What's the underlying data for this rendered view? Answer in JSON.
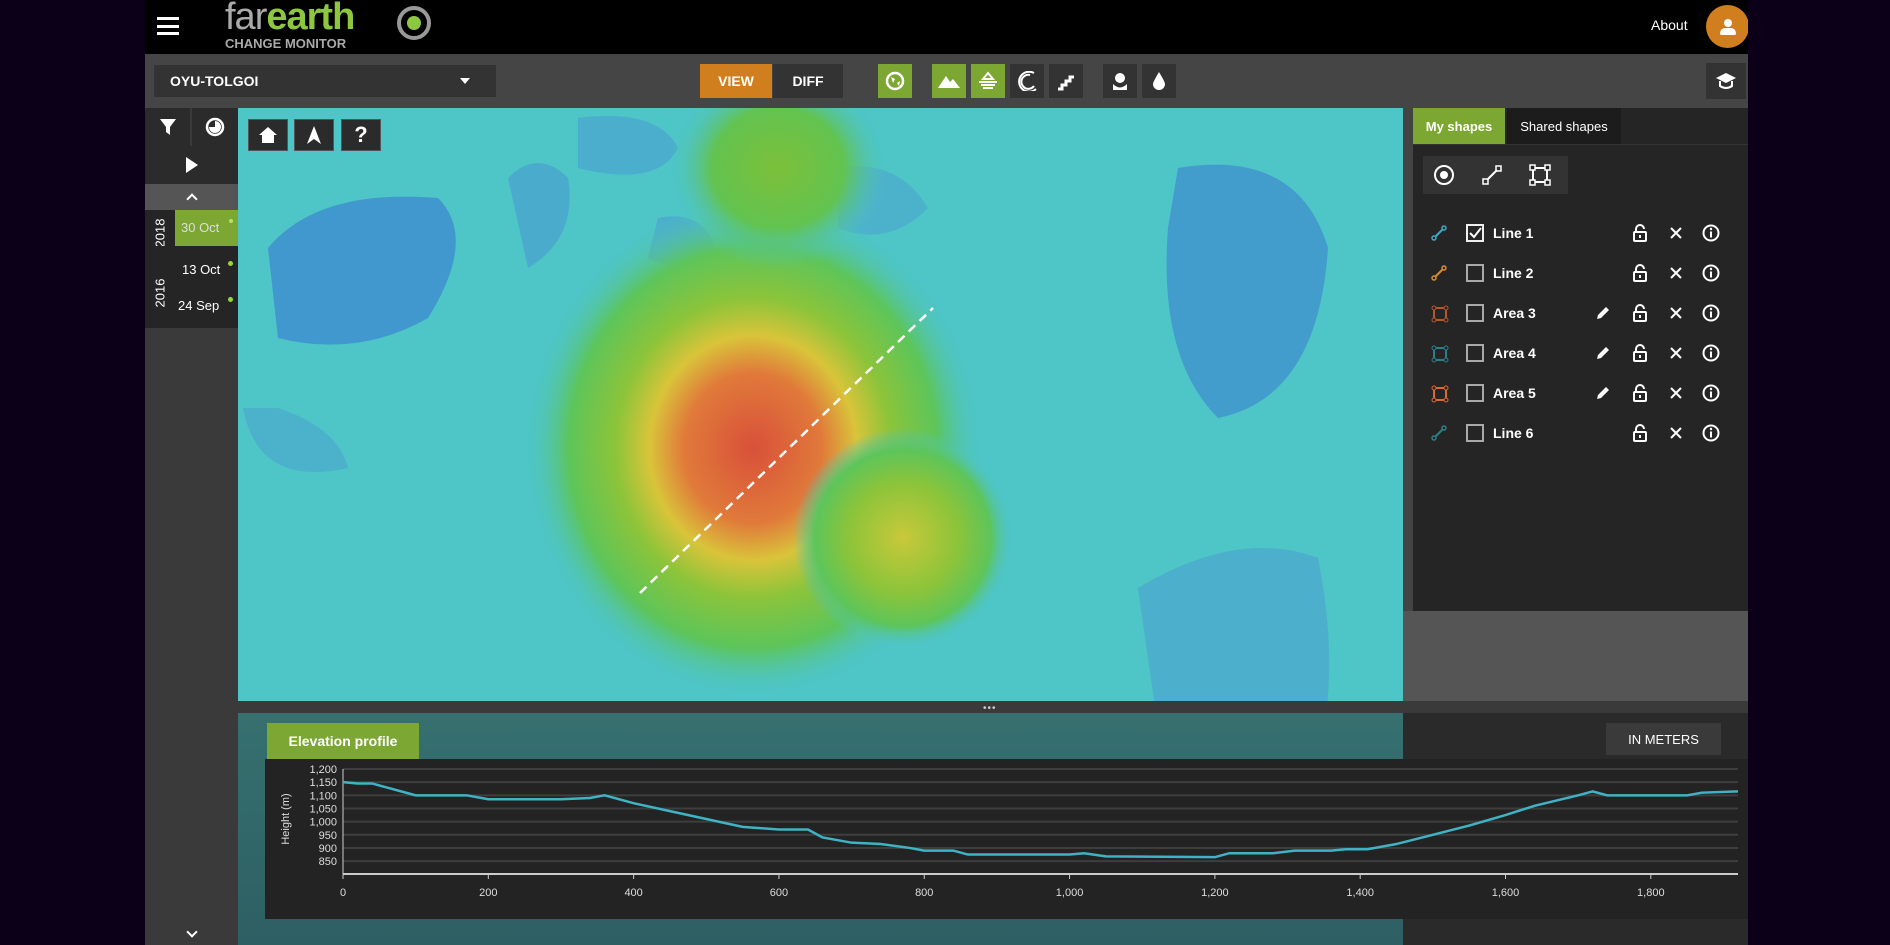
{
  "header": {
    "logo_top_far": "far",
    "logo_top_earth": "earth",
    "logo_bottom": "CHANGE MONITOR",
    "about": "About",
    "menu_icon": "hamburger-icon",
    "avatar_icon": "user-icon",
    "avatar_color": "#d17f1e"
  },
  "toolbar": {
    "site": "OYU-TOLGOI",
    "view": "VIEW",
    "diff": "DIFF",
    "accent_orange": "#d17f1e",
    "accent_green": "#7ba732",
    "icons": [
      "globe-icon",
      "mountain-icon",
      "elevation-layers-icon",
      "contour-icon",
      "stairs-icon",
      "vegetation-icon",
      "water-drop-icon",
      "learn-icon"
    ]
  },
  "sidebar": {
    "dates": [
      {
        "year": "2018",
        "items": [
          "30 Oct"
        ]
      },
      {
        "year": "2016",
        "items": [
          "13 Oct",
          "24 Sep"
        ]
      }
    ],
    "selected": "30 Oct"
  },
  "map_controls": {
    "home": "home-icon",
    "north": "north-arrow-icon",
    "help": "?"
  },
  "shapes": {
    "tabs": [
      "My shapes",
      "Shared shapes"
    ],
    "active_tab": "My shapes",
    "items": [
      {
        "name": "Line 1",
        "type": "line",
        "color": "#3aa9c4",
        "checked": true,
        "editable": false
      },
      {
        "name": "Line 2",
        "type": "line",
        "color": "#d98a2b",
        "checked": false,
        "editable": false
      },
      {
        "name": "Area 3",
        "type": "area",
        "color": "#b8562c",
        "checked": false,
        "editable": true
      },
      {
        "name": "Area 4",
        "type": "area",
        "color": "#2c7f86",
        "checked": false,
        "editable": true
      },
      {
        "name": "Area 5",
        "type": "area",
        "color": "#e0692a",
        "checked": false,
        "editable": true
      },
      {
        "name": "Line 6",
        "type": "line",
        "color": "#2c7f86",
        "checked": false,
        "editable": false
      }
    ]
  },
  "profile": {
    "tab": "Elevation profile",
    "units": "IN METERS"
  },
  "chart_data": {
    "type": "line",
    "xlabel": "",
    "ylabel": "Height (m)",
    "xlim": [
      0,
      1920
    ],
    "ylim": [
      820,
      1200
    ],
    "xticks": [
      0,
      200,
      400,
      600,
      800,
      1000,
      1200,
      1400,
      1600,
      1800
    ],
    "xtick_labels": [
      "0",
      "200",
      "400",
      "600",
      "800",
      "1,000",
      "1,200",
      "1,400",
      "1,600",
      "1,800"
    ],
    "yticks": [
      850,
      900,
      950,
      1000,
      1050,
      1100,
      1150,
      1200
    ],
    "ytick_labels": [
      "850",
      "900",
      "950",
      "1,000",
      "1,050",
      "1,100",
      "1,150",
      "1,200"
    ],
    "grid": true,
    "color": "#3fb3c4",
    "x": [
      0,
      20,
      40,
      60,
      80,
      100,
      170,
      200,
      300,
      340,
      360,
      400,
      450,
      500,
      550,
      600,
      640,
      660,
      700,
      740,
      780,
      800,
      840,
      860,
      1000,
      1020,
      1050,
      1200,
      1220,
      1280,
      1310,
      1360,
      1380,
      1410,
      1450,
      1500,
      1550,
      1600,
      1640,
      1700,
      1720,
      1740,
      1850,
      1870,
      1920
    ],
    "y": [
      1150,
      1145,
      1145,
      1130,
      1115,
      1100,
      1100,
      1085,
      1085,
      1090,
      1100,
      1070,
      1040,
      1010,
      980,
      970,
      970,
      940,
      920,
      915,
      900,
      890,
      890,
      875,
      875,
      880,
      868,
      865,
      880,
      880,
      890,
      890,
      895,
      895,
      915,
      950,
      985,
      1025,
      1060,
      1100,
      1115,
      1100,
      1100,
      1110,
      1115
    ]
  }
}
